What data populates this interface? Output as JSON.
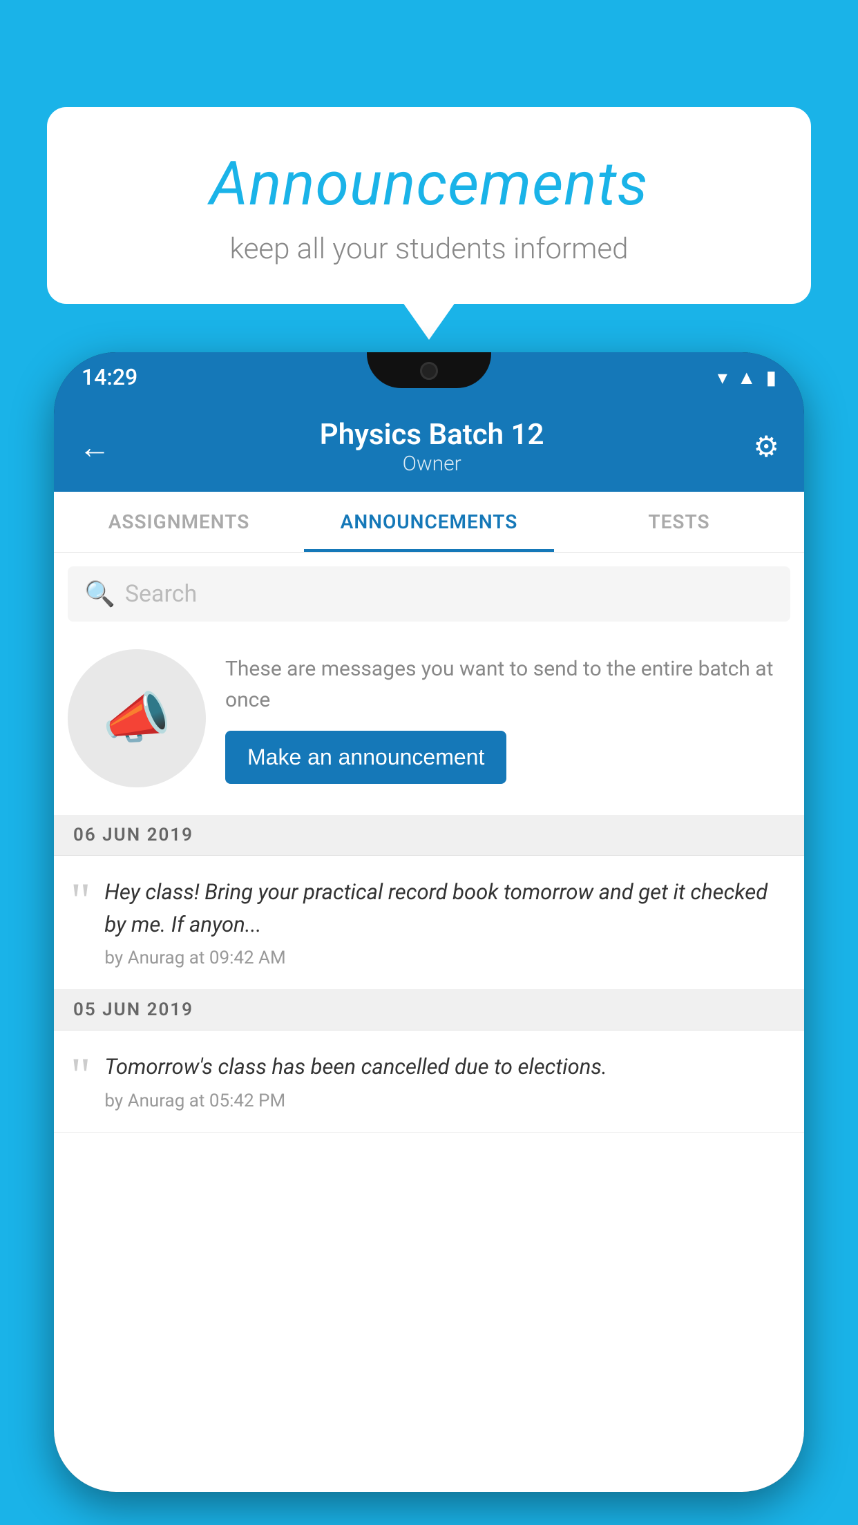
{
  "background": {
    "color": "#1ab3e8"
  },
  "announcement_card": {
    "title": "Announcements",
    "subtitle": "keep all your students informed"
  },
  "phone": {
    "status_bar": {
      "time": "14:29"
    },
    "app_bar": {
      "back_label": "←",
      "title": "Physics Batch 12",
      "subtitle": "Owner",
      "settings_label": "⚙"
    },
    "tabs": [
      {
        "label": "ASSIGNMENTS",
        "active": false
      },
      {
        "label": "ANNOUNCEMENTS",
        "active": true
      },
      {
        "label": "TESTS",
        "active": false
      }
    ],
    "search": {
      "placeholder": "Search"
    },
    "empty_state": {
      "description": "These are messages you want to send to the entire batch at once",
      "button_label": "Make an announcement"
    },
    "announcements": [
      {
        "date": "06  JUN  2019",
        "text": "Hey class! Bring your practical record book tomorrow and get it checked by me. If anyon...",
        "meta": "by Anurag at 09:42 AM"
      },
      {
        "date": "05  JUN  2019",
        "text": "Tomorrow's class has been cancelled due to elections.",
        "meta": "by Anurag at 05:42 PM"
      }
    ]
  }
}
